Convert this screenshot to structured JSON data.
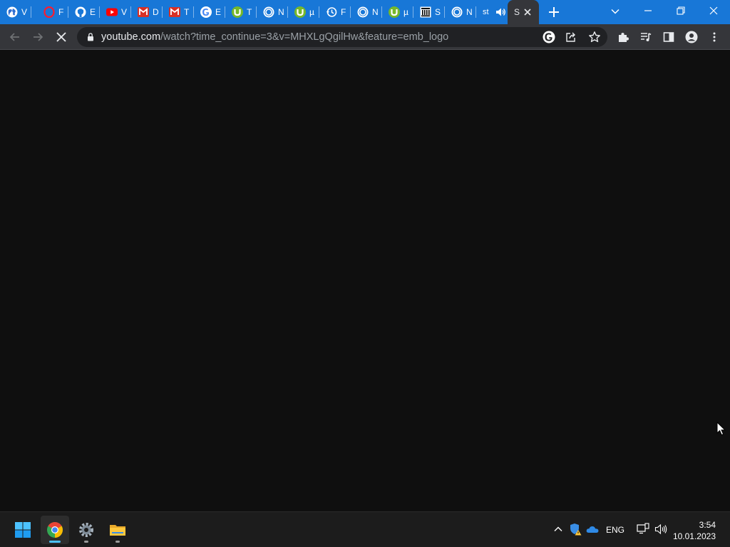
{
  "tabs": [
    {
      "icon": "globe-icon",
      "title": "V"
    },
    {
      "icon": "opera-icon",
      "title": "F"
    },
    {
      "icon": "github-icon",
      "title": "E"
    },
    {
      "icon": "youtube-icon",
      "title": "V"
    },
    {
      "icon": "gmail-icon",
      "title": "D"
    },
    {
      "icon": "gmail-icon",
      "title": "T"
    },
    {
      "icon": "google-icon",
      "title": "E"
    },
    {
      "icon": "utorrent-icon",
      "title": "T"
    },
    {
      "icon": "chrome-icon",
      "title": "N"
    },
    {
      "icon": "utorrent-icon",
      "title": "µ"
    },
    {
      "icon": "history-icon",
      "title": "F"
    },
    {
      "icon": "chrome-icon",
      "title": "N"
    },
    {
      "icon": "utorrent-icon",
      "title": "µ"
    },
    {
      "icon": "bank-icon",
      "title": "S"
    },
    {
      "icon": "chrome-icon",
      "title": "N"
    },
    {
      "icon": "audio-tab",
      "title": "st"
    }
  ],
  "active_tab": {
    "title": "S"
  },
  "toolbar": {
    "url_host": "youtube.com",
    "url_path": "/watch?time_continue=3&v=MHXLgQgilHw&feature=emb_logo"
  },
  "taskbar": {
    "apps": [
      {
        "name": "windows-start",
        "icon": "windows-icon"
      },
      {
        "name": "chrome",
        "icon": "chrome-icon"
      },
      {
        "name": "settings",
        "icon": "gear-icon"
      },
      {
        "name": "file-explorer",
        "icon": "folder-icon"
      }
    ],
    "language": "ENG",
    "time": "3:54",
    "date": "10.01.2023"
  },
  "colors": {
    "tabstrip": "#1877d7",
    "toolbar": "#35363a",
    "omnibox": "#202124",
    "page": "#0f0f0f",
    "taskbar": "#1c1c1c",
    "accent": "#4cc2ff"
  }
}
